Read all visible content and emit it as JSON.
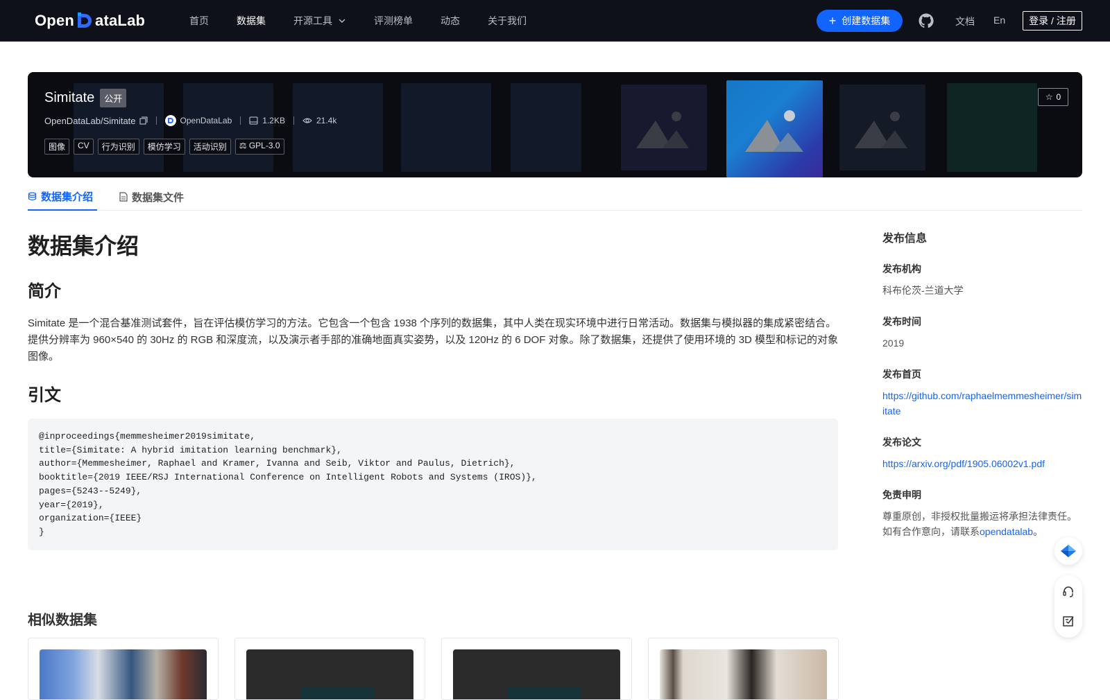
{
  "nav": {
    "logo_text_left": "Open",
    "logo_text_right": "ataLab",
    "items": [
      {
        "label": "首页",
        "active": false
      },
      {
        "label": "数据集",
        "active": true
      },
      {
        "label": "开源工具",
        "active": false,
        "has_dropdown": true
      },
      {
        "label": "评测榜单",
        "active": false
      },
      {
        "label": "动态",
        "active": false
      },
      {
        "label": "关于我们",
        "active": false
      }
    ],
    "create_label": "创建数据集",
    "docs_label": "文档",
    "lang_label": "En",
    "login_label": "登录 / 注册",
    "accent": "#1264ff"
  },
  "dataset": {
    "name": "Simitate",
    "visibility": "公开",
    "path": "OpenDataLab/Simitate",
    "publisher": "OpenDataLab",
    "size": "1.2KB",
    "views": "21.4k",
    "stars": "0",
    "tags": [
      "图像",
      "CV",
      "行为识别",
      "模仿学习",
      "活动识别"
    ],
    "license": "GPL-3.0"
  },
  "tabs": [
    {
      "label": "数据集介绍",
      "icon": "database-icon",
      "active": true
    },
    {
      "label": "数据集文件",
      "icon": "file-icon",
      "active": false
    }
  ],
  "content": {
    "title": "数据集介绍",
    "intro_heading": "简介",
    "intro_text": "Simitate 是一个混合基准测试套件，旨在评估模仿学习的方法。它包含一个包含 1938 个序列的数据集，其中人类在现实环境中进行日常活动。数据集与模拟器的集成紧密结合。提供分辨率为 960×540 的 30Hz 的 RGB 和深度流，以及演示者手部的准确地面真实姿势，以及 120Hz 的 6 DOF 对象。除了数据集，还提供了使用环境的 3D 模型和标记的对象图像。",
    "citation_heading": "引文",
    "citation": "@inproceedings{memmesheimer2019simitate,\ntitle={Simitate: A hybrid imitation learning benchmark},\nauthor={Memmesheimer, Raphael and Kramer, Ivanna and Seib, Viktor and Paulus, Dietrich},\nbooktitle={2019 IEEE/RSJ International Conference on Intelligent Robots and Systems (IROS)},\npages={5243--5249},\nyear={2019},\norganization={IEEE}\n}",
    "similar_heading": "相似数据集"
  },
  "sidebar": {
    "title": "发布信息",
    "org_label": "发布机构",
    "org_value": "科布伦茨-兰道大学",
    "time_label": "发布时间",
    "time_value": "2019",
    "home_label": "发布首页",
    "home_value": "https://github.com/raphaelmemmesheimer/simitate",
    "paper_label": "发布论文",
    "paper_value": "https://arxiv.org/pdf/1905.06002v1.pdf",
    "disclaimer_label": "免责申明",
    "disclaimer_text": "尊重原创，非授权批量搬运将承担法律责任。如有合作意向，请联系",
    "disclaimer_link": "opendatalab",
    "disclaimer_end": "。"
  }
}
